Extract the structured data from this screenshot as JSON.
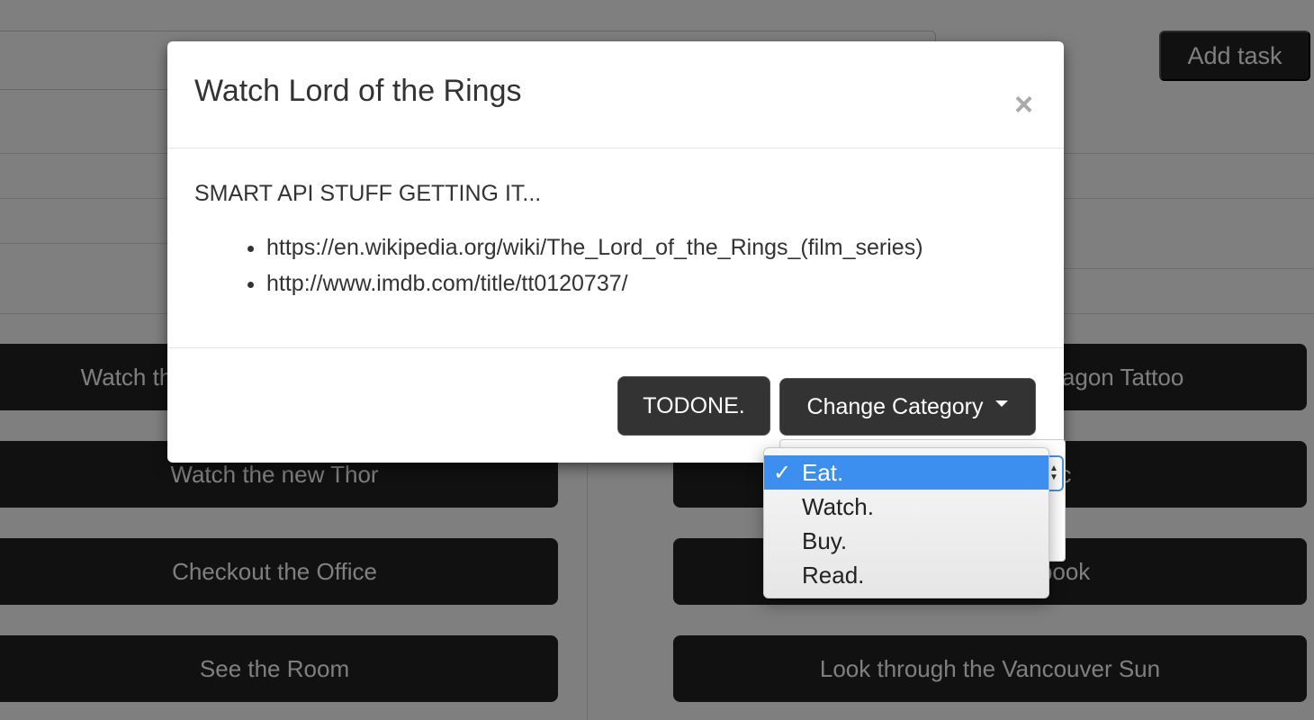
{
  "app": {
    "add_task_label": "Add task"
  },
  "tasks_left": [
    {
      "label": "Watch the Girl with the Dragon Tattoo"
    },
    {
      "label": "Watch the new Thor"
    },
    {
      "label": "Checkout the Office"
    },
    {
      "label": "See the Room"
    }
  ],
  "tasks_right": [
    {
      "label": "Watch the Girl with the Dragon Tattoo"
    },
    {
      "label": "Read the comic"
    },
    {
      "label": "Checkout facebook"
    },
    {
      "label": "Look through the Vancouver Sun"
    }
  ],
  "modal": {
    "title": "Watch Lord of the Rings",
    "close_symbol": "×",
    "body_text": "SMART API STUFF GETTING IT...",
    "links": [
      "https://en.wikipedia.org/wiki/The_Lord_of_the_Rings_(film_series)",
      "http://www.imdb.com/title/tt0120737/"
    ],
    "todone_label": "TODONE.",
    "change_category_label": "Change Category"
  },
  "category_select": {
    "selected": "Eat.",
    "check_symbol": "✓",
    "options": [
      "Eat.",
      "Watch.",
      "Buy.",
      "Read."
    ]
  }
}
